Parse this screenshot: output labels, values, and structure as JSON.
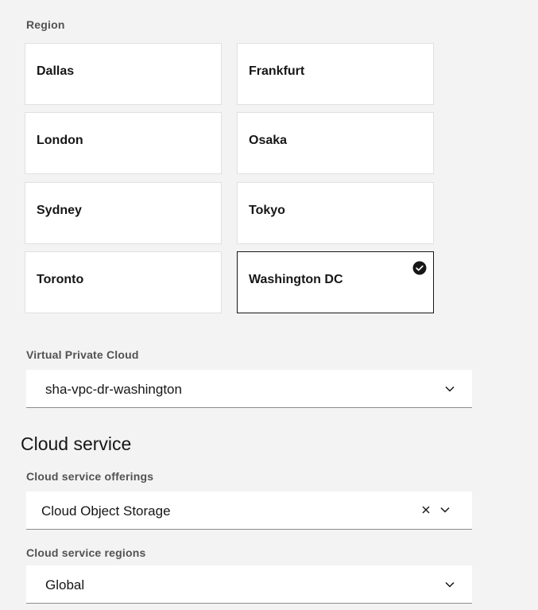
{
  "region": {
    "label": "Region",
    "tiles": [
      {
        "name": "Dallas",
        "selected": false
      },
      {
        "name": "Frankfurt",
        "selected": false
      },
      {
        "name": "London",
        "selected": false
      },
      {
        "name": "Osaka",
        "selected": false
      },
      {
        "name": "Sydney",
        "selected": false
      },
      {
        "name": "Tokyo",
        "selected": false
      },
      {
        "name": "Toronto",
        "selected": false
      },
      {
        "name": "Washington DC",
        "selected": true
      }
    ],
    "selected_icon": "checkmark-filled-icon"
  },
  "vpc": {
    "label": "Virtual Private Cloud",
    "value": "sha-vpc-dr-washington",
    "icon": "chevron-down-icon"
  },
  "cloud_service": {
    "title": "Cloud service",
    "offerings": {
      "label": "Cloud service offerings",
      "value": "Cloud Object Storage",
      "clear_icon": "close-icon",
      "icon": "chevron-down-icon"
    },
    "regions": {
      "label": "Cloud service regions",
      "value": "Global",
      "icon": "chevron-down-icon"
    }
  },
  "colors": {
    "background": "#f3f3f3",
    "tile_background": "#ffffff",
    "selected_border": "#161616",
    "text": "#161616",
    "label": "#525252"
  }
}
